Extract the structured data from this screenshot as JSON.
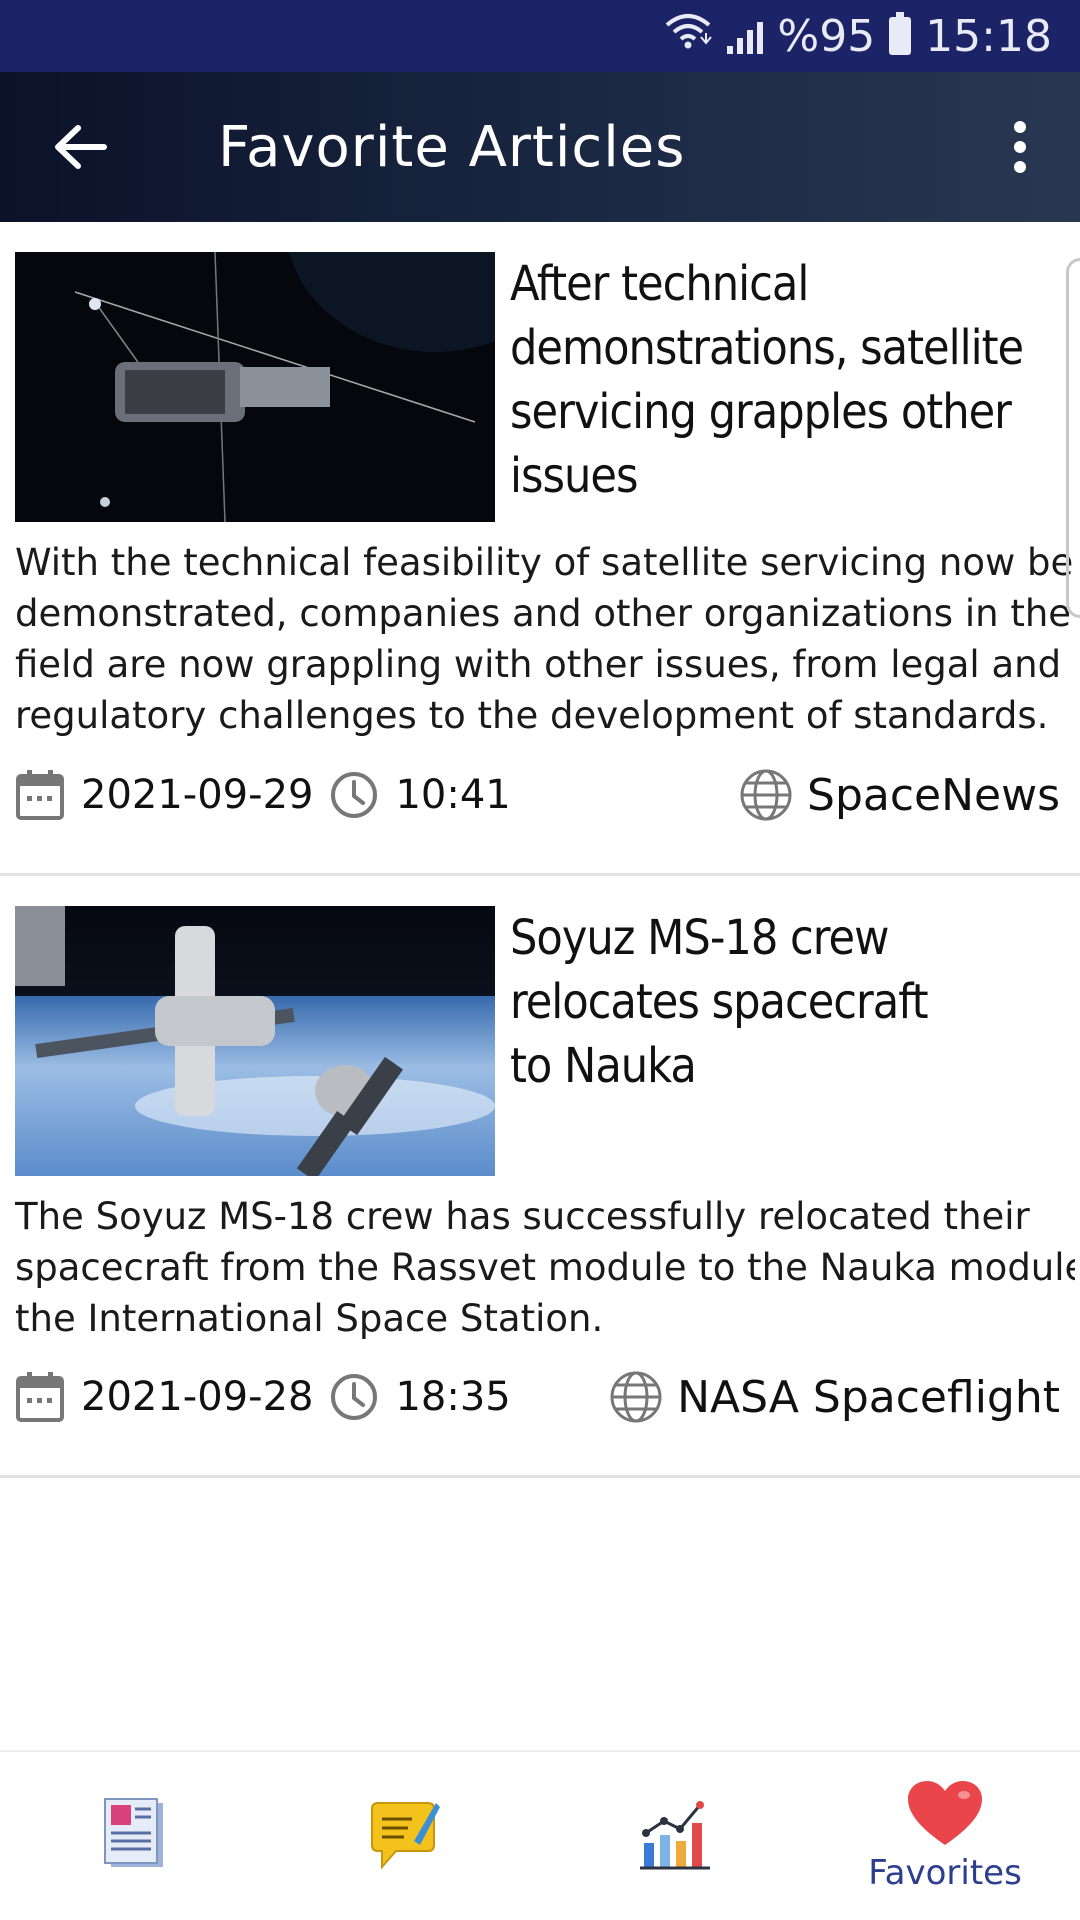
{
  "status_bar": {
    "battery_percent": "%95",
    "time": "15:18"
  },
  "app_bar": {
    "title": "Favorite Articles"
  },
  "articles": [
    {
      "title": "After technical demonstrations, satellite servicing grapples other issues",
      "title_lines": [
        "After technical",
        "demonstrations, satellite",
        "servicing grapples other",
        "issues"
      ],
      "description_lines": [
        "With the technical feasibility of satellite servicing now being",
        "demonstrated, companies and other organizations in the",
        "field are now grappling with other issues, from legal and",
        "regulatory challenges to the development of standards."
      ],
      "date": "2021-09-29",
      "time": "10:41",
      "source": "SpaceNews"
    },
    {
      "title": "Soyuz MS-18 crew relocates spacecraft to Nauka",
      "title_lines": [
        "Soyuz MS-18 crew",
        "relocates spacecraft",
        "to Nauka"
      ],
      "description_lines": [
        "The Soyuz MS-18 crew has successfully relocated their",
        "spacecraft from the Rassvet module to the Nauka module at",
        "the International Space Station."
      ],
      "date": "2021-09-28",
      "time": "18:35",
      "source": "NASA Spaceflight"
    }
  ],
  "bottom_nav": {
    "items": [
      {
        "icon": "news-icon",
        "label": ""
      },
      {
        "icon": "comment-icon",
        "label": ""
      },
      {
        "icon": "stats-chart-icon",
        "label": ""
      },
      {
        "icon": "heart-icon",
        "label": "Favorites"
      }
    ]
  },
  "colors": {
    "status_bar": "#1c2467",
    "nav_active": "#2c3e8f",
    "heart": "#e9454a"
  }
}
